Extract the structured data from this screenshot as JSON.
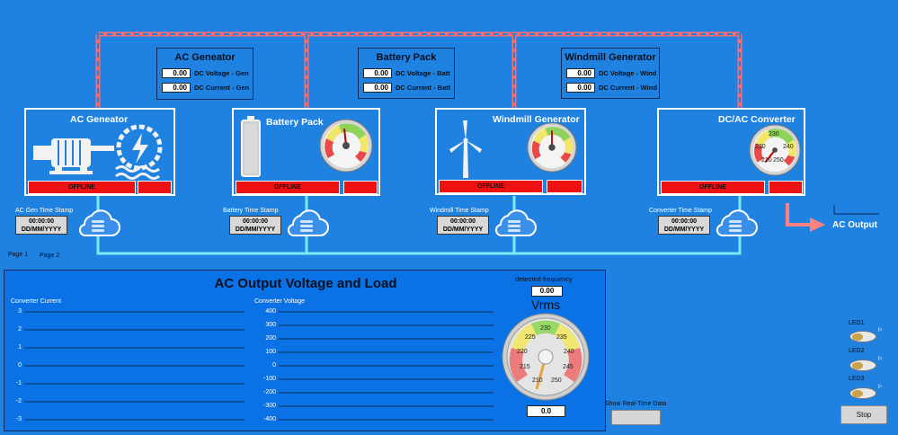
{
  "info_boxes": [
    {
      "title": "AC Geneator",
      "rows": [
        {
          "value": "0.00",
          "label": "DC Voltage - Gen"
        },
        {
          "value": "0.00",
          "label": "DC Current - Gen"
        }
      ]
    },
    {
      "title": "Battery Pack",
      "rows": [
        {
          "value": "0.00",
          "label": "DC Voltage - Batt"
        },
        {
          "value": "0.00",
          "label": "DC Current - Batt"
        }
      ]
    },
    {
      "title": "Windmill Generator",
      "rows": [
        {
          "value": "0.00",
          "label": "DC Voltage - Wind"
        },
        {
          "value": "0.00",
          "label": "DC Current - Wind"
        }
      ]
    }
  ],
  "panels": [
    {
      "title": "AC Geneator",
      "status": "OFFLINE",
      "timestamp_label": "AC Gen Time Stamp",
      "time": "00:00:00",
      "date": "DD/MM/YYYY"
    },
    {
      "title": "Battery Pack",
      "status": "OFFLINE",
      "timestamp_label": "Battery Time Stamp",
      "time": "00:00:00",
      "date": "DD/MM/YYYY"
    },
    {
      "title": "Windmill Generator",
      "status": "OFFLINE",
      "timestamp_label": "Windmill Time Stamp",
      "time": "00:00:00",
      "date": "DD/MM/YYYY"
    },
    {
      "title": "DC/AC Converter",
      "status": "OFFLINE",
      "timestamp_label": "Converter Time Stamp",
      "time": "00:00:00",
      "date": "DD/MM/YYYY",
      "gauge_ticks": [
        "230",
        "220",
        "240",
        "210",
        "250"
      ]
    }
  ],
  "ac_output_label": "AC Output",
  "pages": {
    "page1": "Page 1",
    "page2": "Page 2"
  },
  "bottom": {
    "title": "AC Output Voltage and Load",
    "converter_current": {
      "label": "Converter Current",
      "ticks": [
        "3",
        "2",
        "1",
        "0",
        "-1",
        "-2",
        "-3"
      ]
    },
    "converter_voltage": {
      "label": "Converter Voltage",
      "ticks": [
        "400",
        "300",
        "200",
        "100",
        "0",
        "-100",
        "-200",
        "-300",
        "-400"
      ]
    },
    "frequency": {
      "label": "detected frequency",
      "value": "0.00"
    },
    "vrms": {
      "label": "Vrms",
      "value": "0.0",
      "ticks": [
        "230",
        "225",
        "235",
        "220",
        "240",
        "215",
        "245",
        "210",
        "250"
      ]
    }
  },
  "show_realtime_label": "Show Real-Time Data",
  "leds": [
    {
      "label": "LED1"
    },
    {
      "label": "LED2"
    },
    {
      "label": "LED3"
    }
  ],
  "stop_label": "Stop",
  "colors": {
    "background": "#1f82e0",
    "status_red": "#ee1111",
    "pipe_red": "#ff5a5a",
    "pipe_cyan": "#7fe8f5"
  }
}
